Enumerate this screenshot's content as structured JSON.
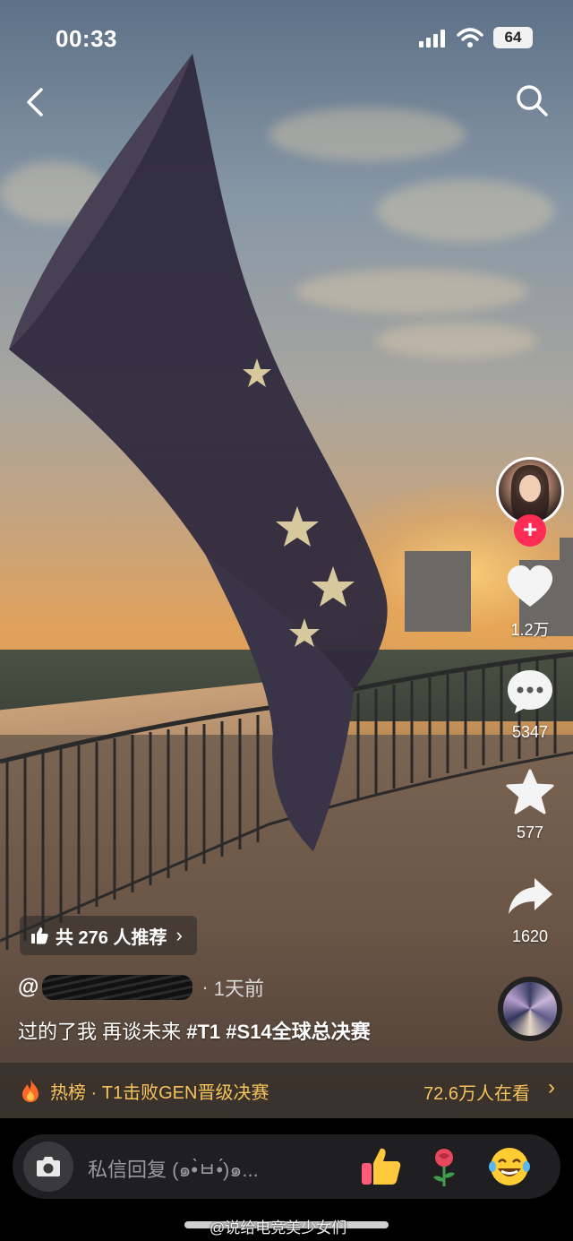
{
  "status_bar": {
    "time": "00:33",
    "battery": "64"
  },
  "side_actions": {
    "likes": "1.2万",
    "comments": "5347",
    "favorites": "577",
    "shares": "1620"
  },
  "recommend": {
    "label": "共 276 人推荐"
  },
  "post": {
    "at_symbol": "@",
    "time_ago": "1天前",
    "caption_text": "过的了我  再谈未来 ",
    "tag1": "#T1",
    "tag2": "#S14全球总决赛"
  },
  "hot": {
    "text": "热榜 · T1击败GEN晋级决赛",
    "viewers": "72.6万人在看"
  },
  "comment_bar": {
    "placeholder": "私信回复 (๑•̀ㅂ•́)๑..."
  },
  "watermark": "@说给电竞美少女们",
  "icons": {
    "back": "back-arrow-icon",
    "search": "search-icon",
    "like": "heart-icon",
    "comment": "comment-bubble-icon",
    "favorite": "star-icon",
    "share": "share-arrow-icon",
    "camera": "camera-icon",
    "hot": "flame-icon"
  },
  "colors": {
    "follow_red": "#fe2c55",
    "hot_yellow": "#f7c35a"
  }
}
